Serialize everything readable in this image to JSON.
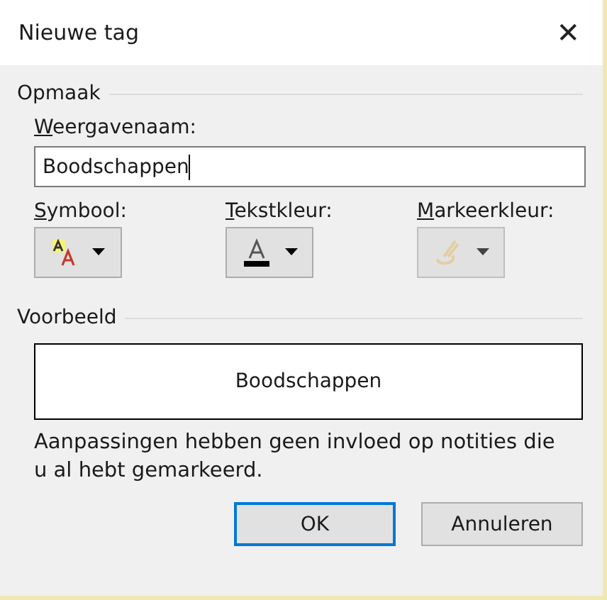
{
  "window": {
    "title": "Nieuwe tag",
    "close": "✕"
  },
  "format_group": {
    "title": "Opmaak",
    "name_field": {
      "label": {
        "key": "W",
        "rest": "eergavenaam:"
      },
      "value": "Boodschappen",
      "focused": true
    },
    "pickers": [
      {
        "kind": "symbol",
        "label": {
          "key": "S",
          "rest": "ymbool:"
        },
        "disabled": false
      },
      {
        "kind": "text_color",
        "label": {
          "key": "T",
          "rest": "ekstkleur:"
        },
        "disabled": false
      },
      {
        "kind": "highlight",
        "label": {
          "key": "M",
          "rest": "arkeerkleur:"
        },
        "disabled": true
      }
    ]
  },
  "preview_group": {
    "title": "Voorbeeld",
    "sample": "Boodschappen"
  },
  "note": "Aanpassingen hebben geen invloed op notities die u al hebt gemarkeerd.",
  "buttons": [
    {
      "label": "OK",
      "default": true
    },
    {
      "label": "Annuleren",
      "default": false
    }
  ]
}
